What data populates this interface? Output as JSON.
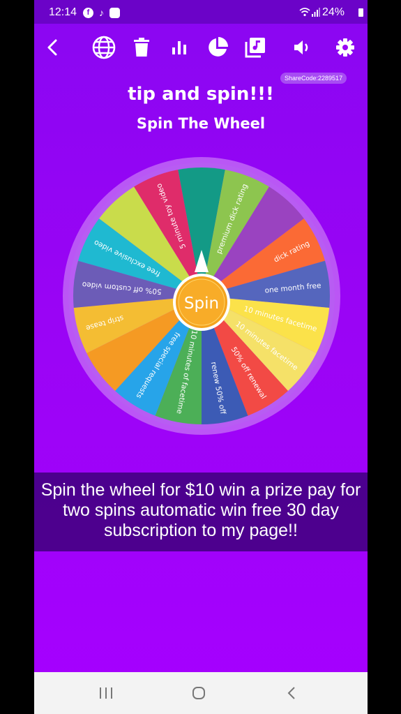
{
  "status_bar": {
    "time": "12:14",
    "battery": "24%",
    "app_icons": [
      "facebook-icon",
      "tiktok-icon",
      "app-notification-icon"
    ]
  },
  "toolbar": {
    "icons": [
      "back-arrow-icon",
      "globe-icon",
      "trash-icon",
      "bar-chart-icon",
      "pie-chart-icon",
      "music-library-icon",
      "volume-icon",
      "settings-gear-icon"
    ]
  },
  "share_code": "ShareCode:2289517",
  "title": "tip and spin!!!",
  "subtitle": "Spin The Wheel",
  "wheel": {
    "center_label": "Spin",
    "segments": [
      {
        "label": "",
        "color": "#139a86"
      },
      {
        "label": "premium dick rating",
        "color": "#8dc54f"
      },
      {
        "label": "",
        "color": "#9a43c0"
      },
      {
        "label": "dick rating",
        "color": "#fb6a35"
      },
      {
        "label": "one month free",
        "color": "#5566bd"
      },
      {
        "label": "10 minutes facetime",
        "color": "#fbe24a"
      },
      {
        "label": "10 minutes facetime",
        "color": "#f5e168"
      },
      {
        "label": "50% off renewal",
        "color": "#f24a45"
      },
      {
        "label": "renew 50% off",
        "color": "#3c5bb5"
      },
      {
        "label": "10 minutes of facetime",
        "color": "#4caf57"
      },
      {
        "label": "free special requests",
        "color": "#27a4e9"
      },
      {
        "label": "",
        "color": "#f59a23"
      },
      {
        "label": "strip tease",
        "color": "#f4bd33"
      },
      {
        "label": "50% off custom video",
        "color": "#6c5cb7"
      },
      {
        "label": "free exclusive video",
        "color": "#1fb9d1"
      },
      {
        "label": "",
        "color": "#c9dc4b"
      },
      {
        "label": "5 minute toy video",
        "color": "#df2c6a"
      }
    ]
  },
  "caption": {
    "lines": [
      "Spin the wheel for $10 win a prize pay for",
      "two spins automatic win free 30 day",
      "subscription to my page!!"
    ]
  },
  "nav_bar": {
    "icons": [
      "recent-apps-icon",
      "home-icon",
      "back-icon"
    ]
  }
}
